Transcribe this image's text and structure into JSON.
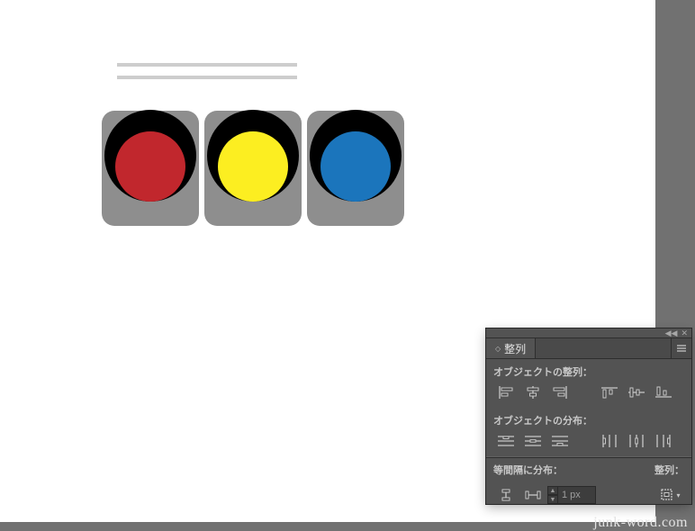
{
  "panel": {
    "title": "整列",
    "sections": {
      "align_label": "オブジェクトの整列：",
      "distribute_label": "オブジェクトの分布：",
      "spacing_label": "等間隔に分布：",
      "alignto_label": "整列："
    },
    "spacing_value": "1 px"
  },
  "canvas": {
    "lights": [
      {
        "color": "#c1272d"
      },
      {
        "color": "#fcee21"
      },
      {
        "color": "#1b75bc"
      }
    ]
  },
  "watermark": "junk-word.com"
}
